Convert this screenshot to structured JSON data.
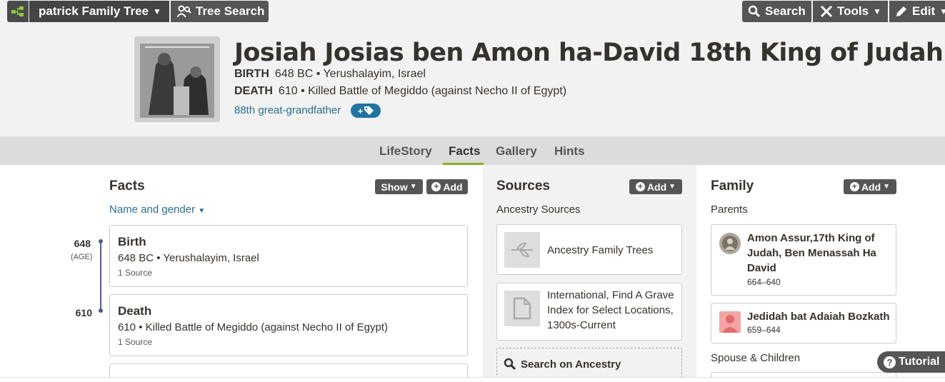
{
  "toolbar": {
    "tree_name": "patrick Family Tree",
    "tree_search": "Tree Search",
    "search": "Search",
    "tools": "Tools",
    "edit": "Edit"
  },
  "person": {
    "name": "Josiah Josias ben Amon ha-David 18th King of Judah",
    "birth_label": "BIRTH",
    "birth_value": "648 BC • Yerushalayim, Israel",
    "death_label": "DEATH",
    "death_value": "610 • Killed Battle of Megiddo (against Necho II of Egypt)",
    "relationship": "88th great-grandfather"
  },
  "tabs": [
    {
      "label": "LifeStory",
      "active": false
    },
    {
      "label": "Facts",
      "active": true
    },
    {
      "label": "Gallery",
      "active": false
    },
    {
      "label": "Hints",
      "active": false
    }
  ],
  "facts": {
    "title": "Facts",
    "show_label": "Show",
    "add_label": "Add",
    "name_gender_link": "Name and gender",
    "timeline": {
      "birth_year": "648",
      "age_label": "(AGE)",
      "death_year": "610"
    },
    "items": [
      {
        "title": "Birth",
        "detail": "648 BC • Yerushalayim, Israel",
        "sources": "1 Source"
      },
      {
        "title": "Death",
        "detail": "610 • Killed Battle of Megiddo (against Necho II of Egypt)",
        "sources": "1 Source"
      }
    ]
  },
  "sources": {
    "title": "Sources",
    "add_label": "Add",
    "subheading": "Ancestry Sources",
    "items": [
      {
        "text": "Ancestry Family Trees",
        "icon": "leaf-icon"
      },
      {
        "text": "International, Find A Grave Index for Select Locations, 1300s-Current",
        "icon": "document-icon"
      }
    ],
    "search_label": "Search on Ancestry"
  },
  "family": {
    "title": "Family",
    "add_label": "Add",
    "parents_label": "Parents",
    "parents": [
      {
        "name": "Amon Assur,17th King of Judah, Ben Menassah Ha David",
        "dates": "664–640"
      },
      {
        "name": "Jedidah bat Adaiah Bozkath",
        "dates": "659–644"
      }
    ],
    "spouse_label": "Spouse & Children"
  },
  "tutorial_label": "Tutorial",
  "colors": {
    "toolbar_bg": "#555555",
    "link": "#2a6d8e",
    "tab_active_underline": "#8aad2e",
    "tag_button": "#2173a0",
    "timeline": "#4a5d87"
  }
}
